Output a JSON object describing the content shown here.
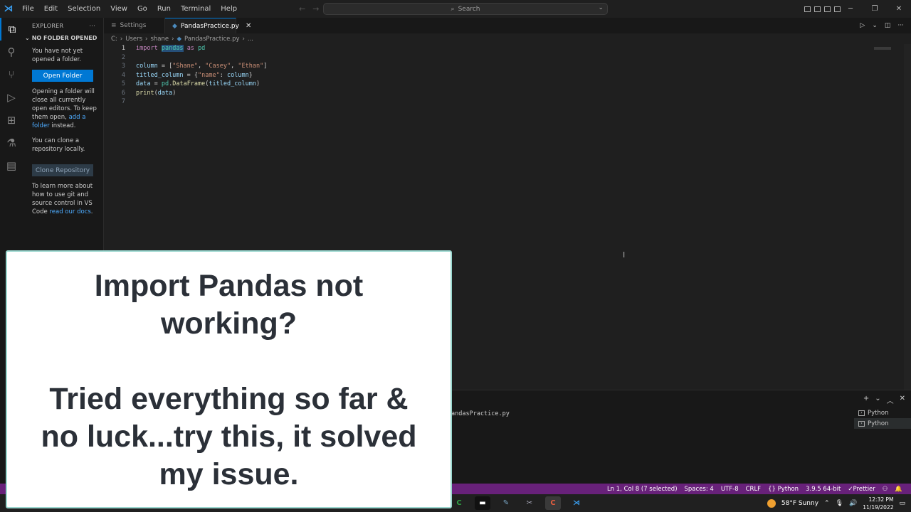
{
  "titlebar": {
    "menu": [
      "File",
      "Edit",
      "Selection",
      "View",
      "Go",
      "Run",
      "Terminal",
      "Help"
    ],
    "search_placeholder": "Search"
  },
  "sidebar": {
    "header": "EXPLORER",
    "section_title": "NO FOLDER OPENED",
    "msg1": "You have not yet opened a folder.",
    "open_folder_label": "Open Folder",
    "msg2_a": "Opening a folder will close all currently open editors. To keep them open,",
    "msg2_link": "add a folder",
    "msg2_b": "instead.",
    "msg3": "You can clone a repository locally.",
    "clone_label": "Clone Repository",
    "msg4_a": "To learn more about how to use git and source control in VS Code",
    "msg4_link": "read our docs",
    "msg4_b": "."
  },
  "tabs": [
    {
      "label": "Settings",
      "active": false
    },
    {
      "label": "PandasPractice.py",
      "active": true
    }
  ],
  "breadcrumb": [
    "C:",
    "Users",
    "shane",
    "PandasPractice.py",
    "..."
  ],
  "editor": {
    "line_numbers": [
      "1",
      "2",
      "3",
      "4",
      "5",
      "6",
      "7"
    ],
    "code": {
      "l1_import": "import",
      "l1_pandas": "pandas",
      "l1_as": "as",
      "l1_pd": "pd",
      "l3_var": "column",
      "l3_eq": " = [",
      "l3_s1": "\"Shane\"",
      "l3_s2": "\"Casey\"",
      "l3_s3": "\"Ethan\"",
      "l3_end": "]",
      "l4_var": "titled_column",
      "l4_eq": " = {",
      "l4_key": "\"name\"",
      "l4_colon": ": ",
      "l4_val": "column",
      "l4_end": "}",
      "l5_var": "data",
      "l5_eq": " = ",
      "l5_pd": "pd",
      "l5_dot": ".",
      "l5_fn": "DataFrame",
      "l5_open": "(",
      "l5_arg": "titled_column",
      "l5_close": ")",
      "l6_fn": "print",
      "l6_open": "(",
      "l6_arg": "data",
      "l6_close": ")"
    }
  },
  "panel": {
    "terminal_text": "andasPractice.py",
    "terminals": [
      "Python",
      "Python"
    ]
  },
  "statusbar": {
    "items": [
      "Ln 1, Col 8 (7 selected)",
      "Spaces: 4",
      "UTF-8",
      "CRLF",
      "Python",
      "3.9.5 64-bit",
      "Prettier"
    ],
    "color": "#68217a"
  },
  "taskbar": {
    "weather": "58°F  Sunny",
    "time": "12:32 PM",
    "date": "11/19/2022"
  },
  "overlay": {
    "line1": "Import Pandas not",
    "line2": "working?",
    "line3": "Tried everything so far &",
    "line4": "no luck...try this, it solved",
    "line5": "my issue."
  }
}
